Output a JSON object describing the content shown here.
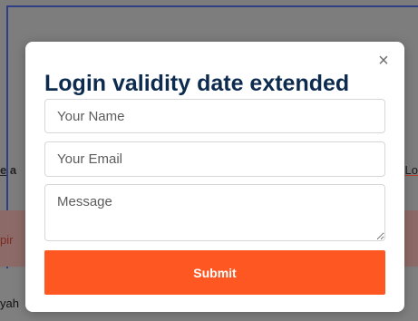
{
  "background": {
    "left_text_underlined": "e",
    "left_text_rest": " a",
    "right_text": "Lo",
    "alert_text": "pir",
    "bottom_text": "yah"
  },
  "modal": {
    "close_label": "×",
    "title": "Login validity date extended",
    "name_placeholder": "Your Name",
    "email_placeholder": "Your Email",
    "message_placeholder": "Message",
    "submit_label": "Submit"
  },
  "colors": {
    "accent": "#ff5722",
    "title": "#0d2b4f"
  }
}
